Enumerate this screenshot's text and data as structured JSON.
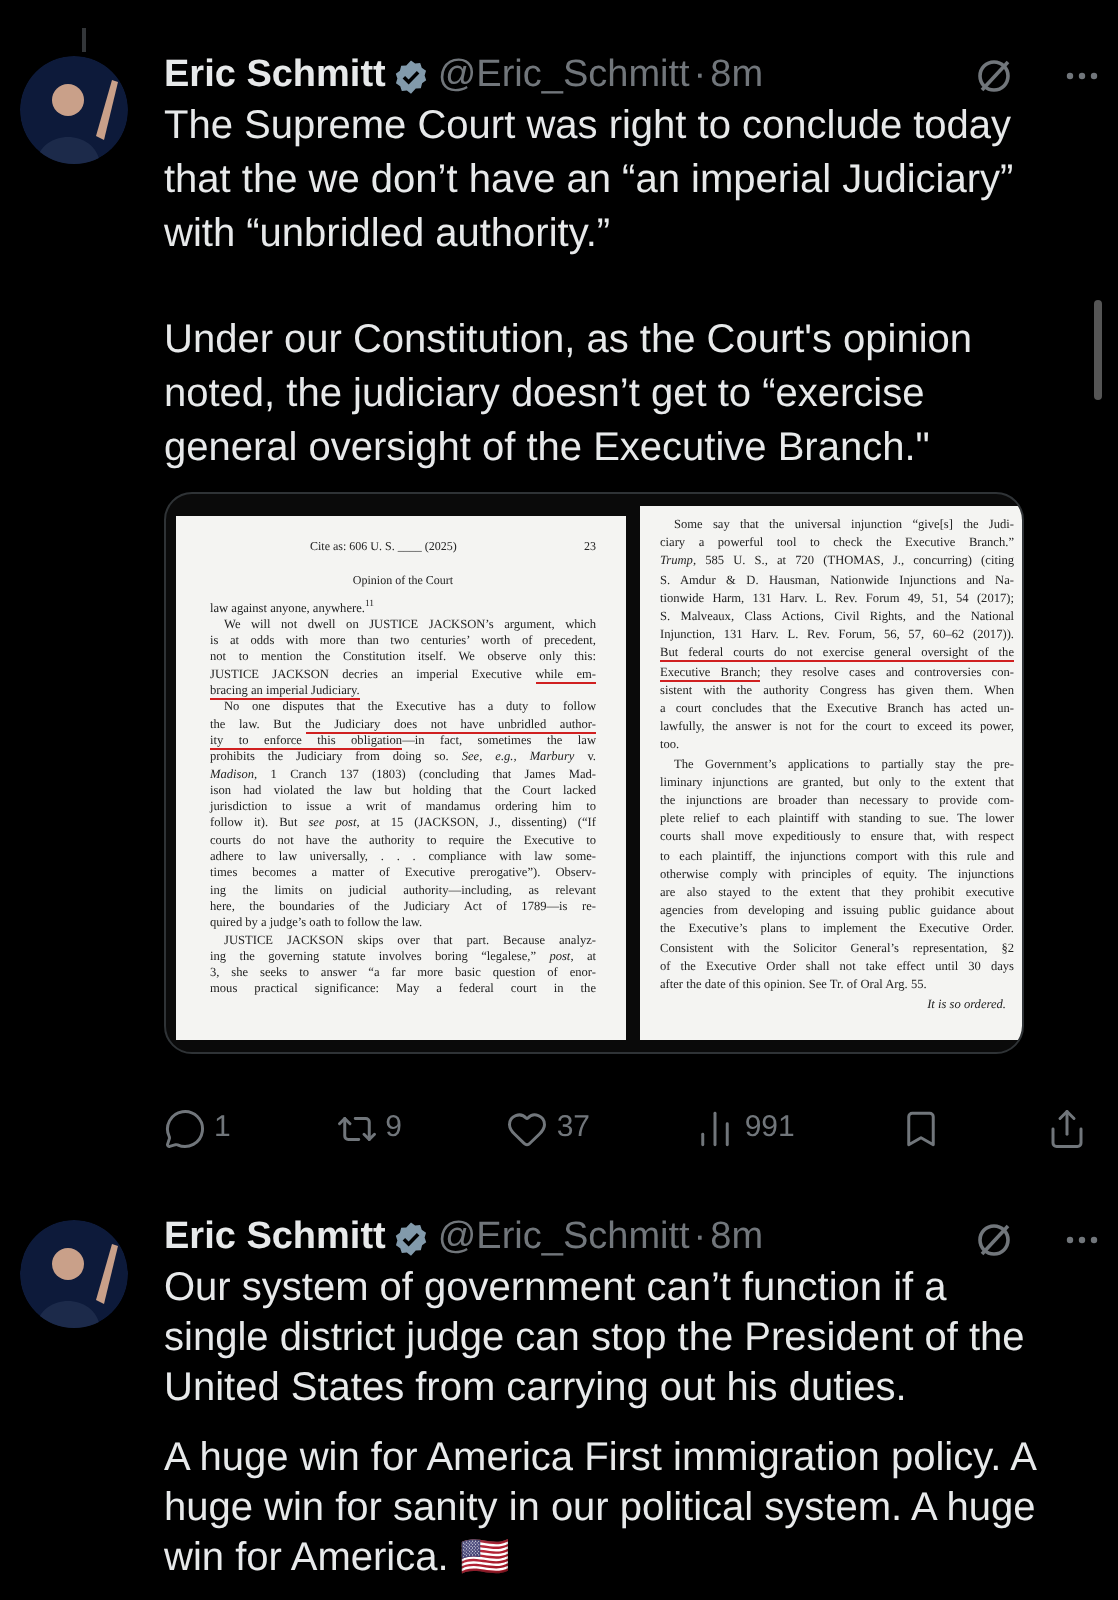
{
  "tweets": [
    {
      "author": "Eric Schmitt",
      "verified": true,
      "handle": "@Eric_Schmitt",
      "separator": "·",
      "time": "8m",
      "paragraphs": [
        "The Supreme Court was right to conclude today that the we don’t have an “an imperial Judiciary” with “unbridled authority.”",
        "Under our Constitution, as the Court's opinion noted, the judiciary doesn’t get to “exercise general oversight of the Executive Branch.\""
      ],
      "media": {
        "pages": [
          {
            "cite": "Cite as: 606 U. S. ____ (2025)",
            "page_number": "23",
            "running_head": "Opinion of the Court",
            "blocks": [
              {
                "indent": false,
                "continues": false,
                "lines": [
                  [
                    {
                      "text": "law against anyone, anywhere.$^{11}$",
                      "underlined": false
                    }
                  ]
                ]
              },
              {
                "indent": true,
                "continues": false,
                "lines": [
                  [
                    {
                      "text": "We will not dwell on JUSTICE JACKSON’s argument, which",
                      "underlined": false
                    }
                  ],
                  [
                    {
                      "text": "is at odds with more than two centuries’ worth of precedent,",
                      "underlined": false
                    }
                  ],
                  [
                    {
                      "text": "not to mention the Constitution itself. We observe only this:",
                      "underlined": false
                    }
                  ],
                  [
                    {
                      "text": "JUSTICE JACKSON decries an imperial Executive ",
                      "underlined": false
                    },
                    {
                      "text": "while em-",
                      "underlined": true
                    }
                  ],
                  [
                    {
                      "text": "bracing an imperial Judiciary.",
                      "underlined": true
                    }
                  ]
                ]
              },
              {
                "indent": true,
                "continues": false,
                "lines": [
                  [
                    {
                      "text": "No one disputes that the Executive has a duty to follow",
                      "underlined": false
                    }
                  ],
                  [
                    {
                      "text": "the law. But ",
                      "underlined": false
                    },
                    {
                      "text": "the Judiciary does not have unbridled author-",
                      "underlined": true
                    }
                  ],
                  [
                    {
                      "text": "ity to enforce this obligation",
                      "underlined": true
                    },
                    {
                      "text": "—in fact, sometimes the law",
                      "underlined": false
                    }
                  ],
                  [
                    {
                      "text": "prohibits the Judiciary from doing so. *See, e.g., Marbury* v.",
                      "underlined": false
                    }
                  ],
                  [
                    {
                      "text": "*Madison*, 1 Cranch 137 (1803) (concluding that James Mad-",
                      "underlined": false
                    }
                  ],
                  [
                    {
                      "text": "ison had violated the law but holding that the Court lacked",
                      "underlined": false
                    }
                  ],
                  [
                    {
                      "text": "jurisdiction to issue a writ of mandamus ordering him to",
                      "underlined": false
                    }
                  ],
                  [
                    {
                      "text": "follow it). But *see post*, at 15 (JACKSON, J., dissenting) (“If",
                      "underlined": false
                    }
                  ],
                  [
                    {
                      "text": "courts do not have the authority to require the Executive to",
                      "underlined": false
                    }
                  ],
                  [
                    {
                      "text": "adhere to law universally, . . . compliance with law some-",
                      "underlined": false
                    }
                  ],
                  [
                    {
                      "text": "times becomes a matter of Executive prerogative”). Observ-",
                      "underlined": false
                    }
                  ],
                  [
                    {
                      "text": "ing the limits on judicial authority—including, as relevant",
                      "underlined": false
                    }
                  ],
                  [
                    {
                      "text": "here, the boundaries of the Judiciary Act of 1789—is re-",
                      "underlined": false
                    }
                  ],
                  [
                    {
                      "text": "quired by a judge’s oath to follow the law.",
                      "underlined": false
                    }
                  ]
                ]
              },
              {
                "indent": true,
                "continues": true,
                "lines": [
                  [
                    {
                      "text": "JUSTICE JACKSON skips over that part. Because analyz-",
                      "underlined": false
                    }
                  ],
                  [
                    {
                      "text": "ing the governing statute involves boring “legalese,” *post*, at",
                      "underlined": false
                    }
                  ],
                  [
                    {
                      "text": "3, she seeks to answer “a far more basic question of enor-",
                      "underlined": false
                    }
                  ],
                  [
                    {
                      "text": "mous practical significance: May a federal court in the",
                      "underlined": false
                    }
                  ]
                ]
              }
            ]
          },
          {
            "blocks": [
              {
                "indent": true,
                "continues": false,
                "lines": [
                  [
                    {
                      "text": "Some say that the universal injunction “give[s] the Judi-",
                      "underlined": false
                    }
                  ],
                  [
                    {
                      "text": "ciary a powerful tool to check the Executive Branch.”",
                      "underlined": false
                    }
                  ],
                  [
                    {
                      "text": "*Trump*, 585 U. S., at 720 (THOMAS, J., concurring) (citing",
                      "underlined": false
                    }
                  ],
                  [
                    {
                      "text": "S. Amdur & D. Hausman, Nationwide Injunctions and Na-",
                      "underlined": false
                    }
                  ],
                  [
                    {
                      "text": "tionwide Harm, 131 Harv. L. Rev. Forum 49, 51, 54 (2017);",
                      "underlined": false
                    }
                  ],
                  [
                    {
                      "text": "S. Malveaux, Class Actions, Civil Rights, and the National",
                      "underlined": false
                    }
                  ],
                  [
                    {
                      "text": "Injunction, 131 Harv. L. Rev. Forum, 56, 57, 60–62 (2017)).",
                      "underlined": false
                    }
                  ],
                  [
                    {
                      "text": "But federal courts do not exercise general oversight of the",
                      "underlined": true
                    }
                  ],
                  [
                    {
                      "text": "Executive Branch;",
                      "underlined": true
                    },
                    {
                      "text": " they resolve cases and controversies con-",
                      "underlined": false
                    }
                  ],
                  [
                    {
                      "text": "sistent with the authority Congress has given them. When",
                      "underlined": false
                    }
                  ],
                  [
                    {
                      "text": "a court concludes that the Executive Branch has acted un-",
                      "underlined": false
                    }
                  ],
                  [
                    {
                      "text": "lawfully, the answer is not for the court to exceed its power,",
                      "underlined": false
                    }
                  ],
                  [
                    {
                      "text": "too.",
                      "underlined": false
                    }
                  ]
                ]
              },
              {
                "indent": true,
                "continues": false,
                "lines": [
                  [
                    {
                      "text": "The Government’s applications to partially stay the pre-",
                      "underlined": false
                    }
                  ],
                  [
                    {
                      "text": "liminary injunctions are granted, but only to the extent that",
                      "underlined": false
                    }
                  ],
                  [
                    {
                      "text": "the injunctions are broader than necessary to provide com-",
                      "underlined": false
                    }
                  ],
                  [
                    {
                      "text": "plete relief to each plaintiff with standing to sue. The lower",
                      "underlined": false
                    }
                  ],
                  [
                    {
                      "text": "courts shall move expeditiously to ensure that, with respect",
                      "underlined": false
                    }
                  ],
                  [
                    {
                      "text": "to each plaintiff, the injunctions comport with this rule and",
                      "underlined": false
                    }
                  ],
                  [
                    {
                      "text": "otherwise comply with principles of equity. The injunctions",
                      "underlined": false
                    }
                  ],
                  [
                    {
                      "text": "are also stayed to the extent that they prohibit executive",
                      "underlined": false
                    }
                  ],
                  [
                    {
                      "text": "agencies from developing and issuing public guidance about",
                      "underlined": false
                    }
                  ],
                  [
                    {
                      "text": "the Executive’s plans to implement the Executive Order.",
                      "underlined": false
                    }
                  ],
                  [
                    {
                      "text": "Consistent with the Solicitor General’s representation, §2",
                      "underlined": false
                    }
                  ],
                  [
                    {
                      "text": "of the Executive Order shall not take effect until 30 days",
                      "underlined": false
                    }
                  ],
                  [
                    {
                      "text": "after the date of this opinion. See Tr. of Oral Arg. 55.",
                      "underlined": false
                    }
                  ]
                ]
              }
            ],
            "closing": "It is so ordered."
          }
        ]
      },
      "actions": [
        {
          "kind": "reply",
          "count": "1"
        },
        {
          "kind": "repost",
          "count": "9"
        },
        {
          "kind": "like",
          "count": "37"
        },
        {
          "kind": "views",
          "count": "991"
        },
        {
          "kind": "bookmark"
        },
        {
          "kind": "share"
        }
      ]
    },
    {
      "author": "Eric Schmitt",
      "verified": true,
      "handle": "@Eric_Schmitt",
      "separator": "·",
      "time": "8m",
      "paragraphs": [
        "Our system of government can’t function if a single district judge can stop the President of the United States from carrying out his duties.",
        "A huge win for America First immigration policy. A huge win for sanity in our political system. A huge win for America. 🇺🇸"
      ]
    }
  ]
}
